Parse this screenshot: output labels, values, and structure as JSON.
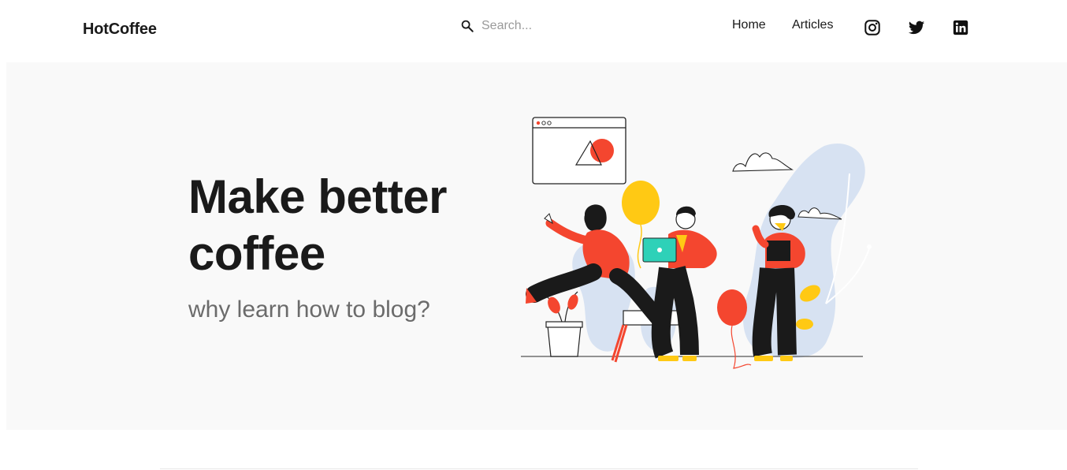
{
  "header": {
    "brand": "HotCoffee",
    "search": {
      "placeholder": "Search...",
      "value": "",
      "icon": "search-icon"
    },
    "nav": [
      {
        "label": "Home"
      },
      {
        "label": "Articles"
      }
    ],
    "social": [
      {
        "name": "instagram",
        "icon": "instagram-icon"
      },
      {
        "name": "twitter",
        "icon": "twitter-icon"
      },
      {
        "name": "linkedin",
        "icon": "linkedin-icon"
      }
    ]
  },
  "hero": {
    "title": "Make better coffee",
    "subtitle": "why learn how to blog?",
    "illustration": "people-celebrating-with-balloons"
  },
  "colors": {
    "text": "#1a1a1a",
    "muted": "#6b6b6b",
    "hero_bg": "#f9f9f9",
    "accent_red": "#f4462f",
    "accent_yellow": "#ffc914",
    "accent_teal": "#2ed1b8",
    "accent_blue": "#d7e2f2"
  }
}
